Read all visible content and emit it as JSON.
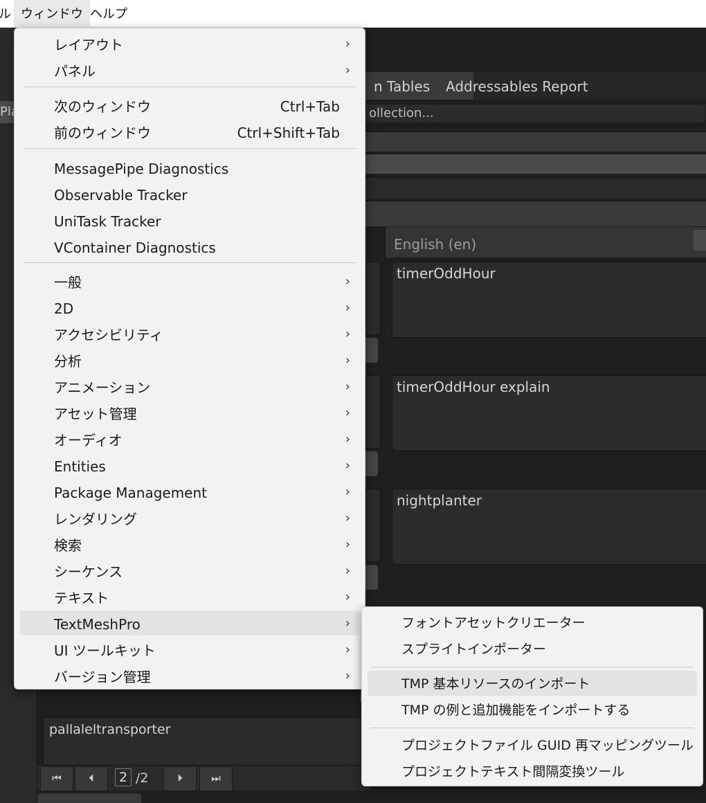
{
  "menubar": {
    "items": [
      "ル",
      "ウィンドウ",
      "ヘルプ"
    ]
  },
  "editor": {
    "left_label": "Pla",
    "tabs": [
      "n Tables",
      "Addressables Report"
    ],
    "collection_field": "ollection...",
    "column_header": "English (en)",
    "cells": [
      "timerOddHour",
      "timerOddHour explain",
      "nightplanter"
    ],
    "bottom_cell": "pallaleltransporter",
    "pager": {
      "first_icon": "⏮",
      "prev_icon": "⏴",
      "current_page": "2",
      "total": "/2",
      "next_icon": "⏵",
      "last_icon": "⏭"
    }
  },
  "main_menu": {
    "items": [
      {
        "label": "レイアウト",
        "submenu": true
      },
      {
        "label": "パネル",
        "submenu": true
      },
      {
        "label": "次のウィンドウ",
        "shortcut": "Ctrl+Tab"
      },
      {
        "label": "前のウィンドウ",
        "shortcut": "Ctrl+Shift+Tab"
      },
      {
        "label": "MessagePipe Diagnostics"
      },
      {
        "label": "Observable Tracker"
      },
      {
        "label": "UniTask Tracker"
      },
      {
        "label": "VContainer Diagnostics"
      },
      {
        "label": "一般",
        "submenu": true
      },
      {
        "label": "2D",
        "submenu": true
      },
      {
        "label": "アクセシビリティ",
        "submenu": true
      },
      {
        "label": "分析",
        "submenu": true
      },
      {
        "label": "アニメーション",
        "submenu": true
      },
      {
        "label": "アセット管理",
        "submenu": true
      },
      {
        "label": "オーディオ",
        "submenu": true
      },
      {
        "label": "Entities",
        "submenu": true
      },
      {
        "label": "Package Management",
        "submenu": true
      },
      {
        "label": "レンダリング",
        "submenu": true
      },
      {
        "label": "検索",
        "submenu": true
      },
      {
        "label": "シーケンス",
        "submenu": true
      },
      {
        "label": "テキスト",
        "submenu": true
      },
      {
        "label": "TextMeshPro",
        "submenu": true,
        "highlighted": true
      },
      {
        "label": "UI ツールキット",
        "submenu": true
      },
      {
        "label": "バージョン管理",
        "submenu": true
      }
    ],
    "arrow_glyph": "›"
  },
  "sub_menu": {
    "items": [
      {
        "label": "フォントアセットクリエーター"
      },
      {
        "label": "スプライトインポーター"
      },
      {
        "label": "TMP 基本リソースのインポート",
        "highlighted": true
      },
      {
        "label": "TMP の例と追加機能をインポートする"
      },
      {
        "label": "プロジェクトファイル GUID 再マッピングツール"
      },
      {
        "label": "プロジェクトテキスト間隔変換ツール"
      }
    ]
  },
  "colors": {
    "menu_bg": "#f2f2f2",
    "menu_hover": "#e3e3e3",
    "editor_bg": "#1f1f1f",
    "menubar_bg": "#ffffff"
  }
}
